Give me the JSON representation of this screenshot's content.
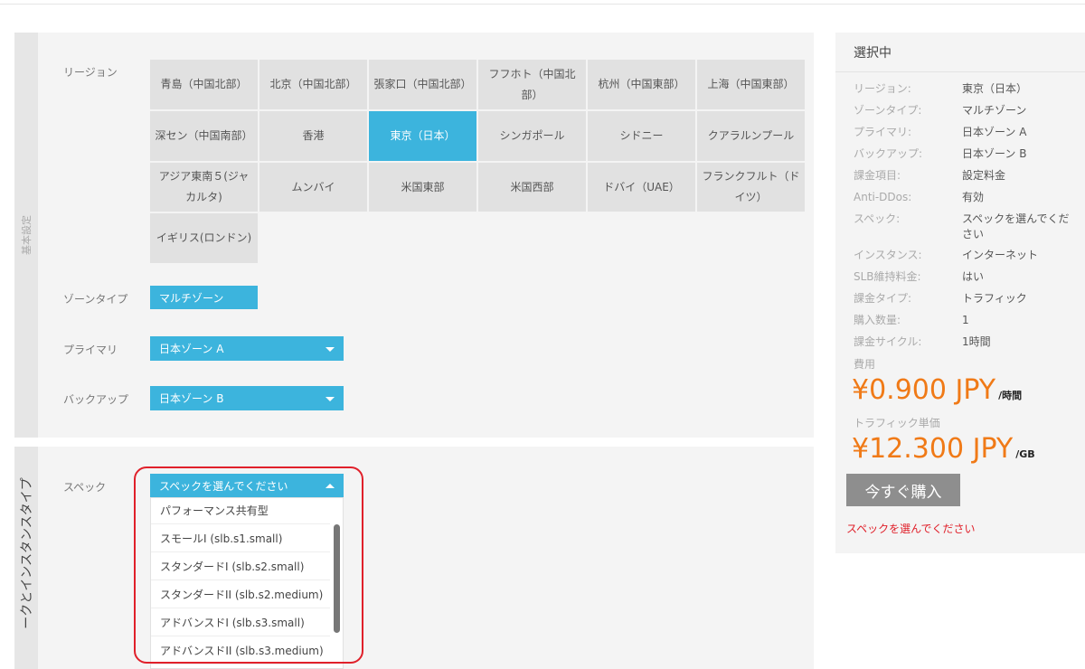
{
  "sections": {
    "basic_label": "基本設定",
    "network_label": "ークとインスタンスタイプ"
  },
  "labels": {
    "region": "リージョン",
    "zone_type": "ゾーンタイプ",
    "primary": "プライマリ",
    "backup": "バックアップ",
    "spec": "スペック"
  },
  "regions": [
    {
      "name": "青島（中国北部）",
      "selected": false
    },
    {
      "name": "北京（中国北部）",
      "selected": false
    },
    {
      "name": "張家口（中国北部）",
      "selected": false
    },
    {
      "name": "フフホト（中国北部）",
      "selected": false
    },
    {
      "name": "杭州（中国東部）",
      "selected": false
    },
    {
      "name": "上海（中国東部）",
      "selected": false
    },
    {
      "name": "深セン（中国南部）",
      "selected": false
    },
    {
      "name": "香港",
      "selected": false
    },
    {
      "name": "東京（日本）",
      "selected": true
    },
    {
      "name": "シンガポール",
      "selected": false
    },
    {
      "name": "シドニー",
      "selected": false
    },
    {
      "name": "クアラルンプール",
      "selected": false
    },
    {
      "name": "アジア東南５(ジャカルタ)",
      "selected": false
    },
    {
      "name": "ムンバイ",
      "selected": false
    },
    {
      "name": "米国東部",
      "selected": false
    },
    {
      "name": "米国西部",
      "selected": false
    },
    {
      "name": "ドバイ（UAE）",
      "selected": false
    },
    {
      "name": "フランクフルト（ドイツ）",
      "selected": false
    },
    {
      "name": "イギリス(ロンドン)",
      "selected": false
    }
  ],
  "zone_type_button": "マルチゾーン",
  "primary_select": "日本ゾーン A",
  "backup_select": "日本ゾーン B",
  "spec_select": {
    "value": "スペックを選んでください",
    "options": [
      "パフォーマンス共有型",
      "スモールI (slb.s1.small)",
      "スタンダードI (slb.s2.small)",
      "スタンダードII (slb.s2.medium)",
      "アドバンスドI (slb.s3.small)",
      "アドバンスドII (slb.s3.medium)"
    ]
  },
  "summary": {
    "title": "選択中",
    "rows": [
      {
        "key": "リージョン:",
        "value": "東京（日本）"
      },
      {
        "key": "ゾーンタイプ:",
        "value": "マルチゾーン"
      },
      {
        "key": "プライマリ:",
        "value": "日本ゾーン A"
      },
      {
        "key": "バックアップ:",
        "value": "日本ゾーン B"
      },
      {
        "key": "課金項目:",
        "value": "設定料金"
      },
      {
        "key": "Anti-DDos:",
        "value": "有効"
      },
      {
        "key": "スペック:",
        "value": "スペックを選んでください"
      },
      {
        "key": "インスタンス:",
        "value": "インターネット"
      },
      {
        "key": "SLB維持料金:",
        "value": "はい"
      },
      {
        "key": "課金タイプ:",
        "value": "トラフィック"
      },
      {
        "key": "購入数量:",
        "value": "1"
      },
      {
        "key": "課金サイクル:",
        "value": "1時間"
      }
    ],
    "fee_label": "費用",
    "fee_amount": "¥0.900 JPY",
    "fee_unit": "/時間",
    "traffic_label": "トラフィック単価",
    "traffic_amount": "¥12.300 JPY",
    "traffic_unit": "/GB",
    "buy_button": "今すぐ購入",
    "warning": "スペックを選んでください"
  },
  "colors": {
    "accent": "#3cb4dd",
    "price": "#f07a17",
    "warning": "#e0202a"
  }
}
